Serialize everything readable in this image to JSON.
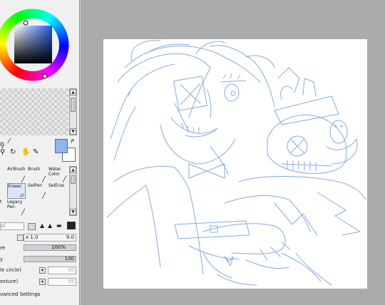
{
  "colors": {
    "foreground": "#8fb4f2",
    "background": "#ffffff",
    "sketch_stroke": "#7aa0e0",
    "canvas_bg": "#ababab",
    "paper": "#ffffff"
  },
  "tools": {
    "row1": [
      "AirBrush",
      "Brush",
      "Water Color"
    ],
    "row2": [
      "Eraser",
      "SelPen",
      "SelEras"
    ],
    "row3_partial": "t",
    "row3": [
      "Legacy Pen"
    ]
  },
  "brush_settings": {
    "mode_label": "al",
    "size_multiplier": "x 1.0",
    "size_value": "9.0",
    "min_size_label": "re",
    "min_size_value": "100%",
    "density_label": "y",
    "density_value": "100",
    "shape_label": "le circle)",
    "shape_value": "50",
    "texture_label": "exture)",
    "texture_value": "95",
    "advanced_label": "vanced Settings"
  },
  "icons": [
    "lasso-select-icon",
    "magic-wand-icon",
    "zoom-icon",
    "rotate-icon",
    "hand-icon",
    "eyedropper-icon",
    "swap-colors-icon",
    "reset-colors-icon"
  ]
}
